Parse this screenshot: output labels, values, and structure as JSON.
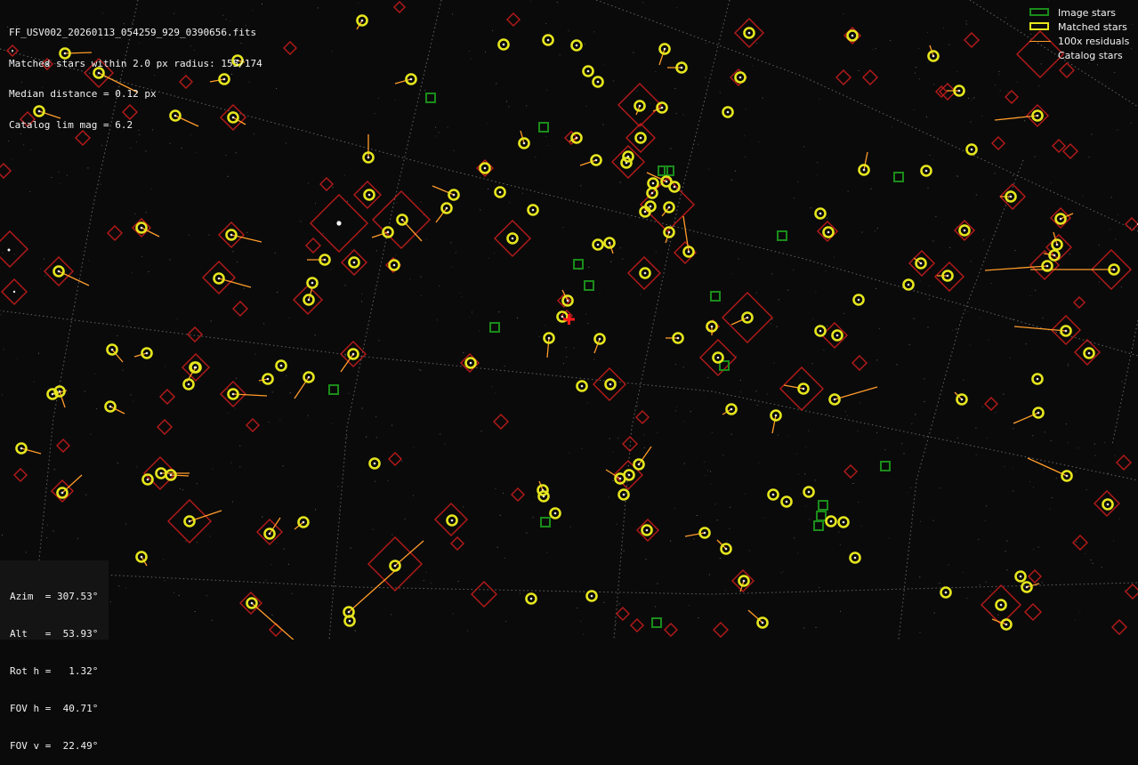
{
  "header": {
    "filename": "FF_USV002_20260113_054259_929_0390656.fits",
    "matched_line": "Matched stars within 2.0 px radius: 155/174",
    "median_line": "Median distance = 0.12 px",
    "catalog_line": "Catalog lim mag = 6.2"
  },
  "legend": {
    "items": [
      {
        "label": "Image stars",
        "symbol": "green-square"
      },
      {
        "label": "Matched stars",
        "symbol": "yellow-square"
      },
      {
        "label": "100x residuals",
        "symbol": "orange-line"
      },
      {
        "label": "Catalog stars",
        "symbol": "none"
      }
    ]
  },
  "pointing": {
    "azim": "Azim  = 307.53°",
    "alt": "Alt   =  53.93°",
    "rot": "Rot h =   1.32°",
    "fov_h": "FOV h =  40.71°",
    "fov_v": "FOV v =  22.49°"
  },
  "colors": {
    "background": "#0a0a0a",
    "image_star": "#1a8c1a",
    "matched_star": "#e6e61e",
    "residual": "#ff9c2a",
    "catalog_star": "#c21b1b",
    "grid": "#8a8a8a",
    "center_marker": "#ff1a1a"
  }
}
